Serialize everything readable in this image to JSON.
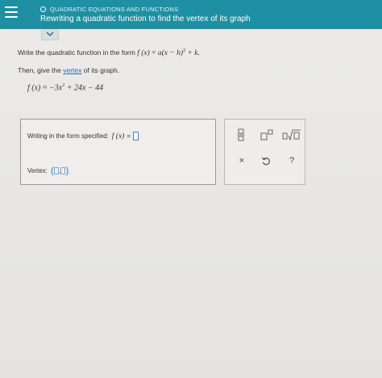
{
  "header": {
    "topic": "QUADRATIC EQUATIONS AND FUNCTIONS",
    "title": "Rewriting a quadratic function to find the vertex of its graph"
  },
  "instructions": {
    "line1_prefix": "Write the quadratic function in the form",
    "form_fx": "f (x)",
    "form_eq": "=",
    "form_rhs_a": "a",
    "form_rhs_paren": "(x − h)",
    "form_rhs_sup": "2",
    "form_rhs_tail": "+ k.",
    "line2_prefix": "Then, give the",
    "line2_link": "vertex",
    "line2_suffix": "of its graph."
  },
  "equation": {
    "lhs": "f (x)",
    "eq": "=",
    "t1": "−3x",
    "t1_sup": "2",
    "t2": "+ 24x − 44"
  },
  "answer": {
    "form_label": "Writing in the form specified:",
    "form_fx": "f (x)",
    "form_eq": "=",
    "vertex_label": "Vertex:",
    "vertex_open": "(",
    "vertex_comma": ",",
    "vertex_close": ")"
  },
  "palette": {
    "clear_symbol": "×",
    "help_symbol": "?"
  },
  "colors": {
    "header_bg": "#1f8fa3",
    "link": "#2a6fb0",
    "input_border": "#3b7fc4"
  }
}
